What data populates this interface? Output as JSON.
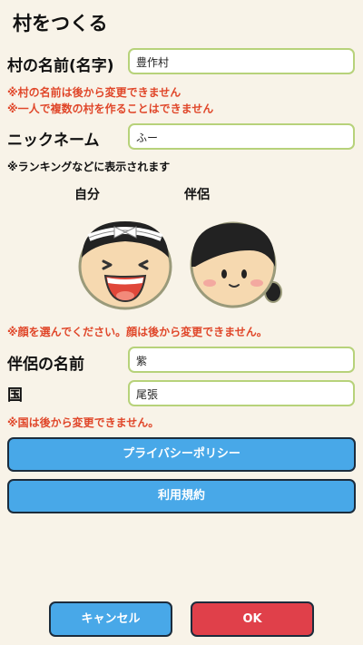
{
  "header": {
    "title": "村をつくる"
  },
  "village": {
    "label": "村の名前(名字)",
    "value": "豊作村"
  },
  "warnings": [
    "※村の名前は後から変更できません",
    "※一人で複数の村を作ることはできません"
  ],
  "nickname": {
    "label": "ニックネーム",
    "value": "ふー"
  },
  "ranking_note": "※ランキングなどに表示されます",
  "faces": {
    "self_label": "自分",
    "partner_label": "伴侶",
    "note": "※顔を選んでください。顔は後から変更できません。"
  },
  "partner_name": {
    "label": "伴侶の名前",
    "value": "紫"
  },
  "country": {
    "label": "国",
    "value": "尾張"
  },
  "country_note": "※国は後から変更できません。",
  "buttons": {
    "privacy": "プライバシーポリシー",
    "terms": "利用規約",
    "cancel": "キャンセル",
    "ok": "OK"
  },
  "colors": {
    "background": "#f8f3e8",
    "field_border": "#b7d27a",
    "warning_text": "#e0472a",
    "primary_button": "#48a8e8",
    "ok_button": "#e0404a"
  }
}
